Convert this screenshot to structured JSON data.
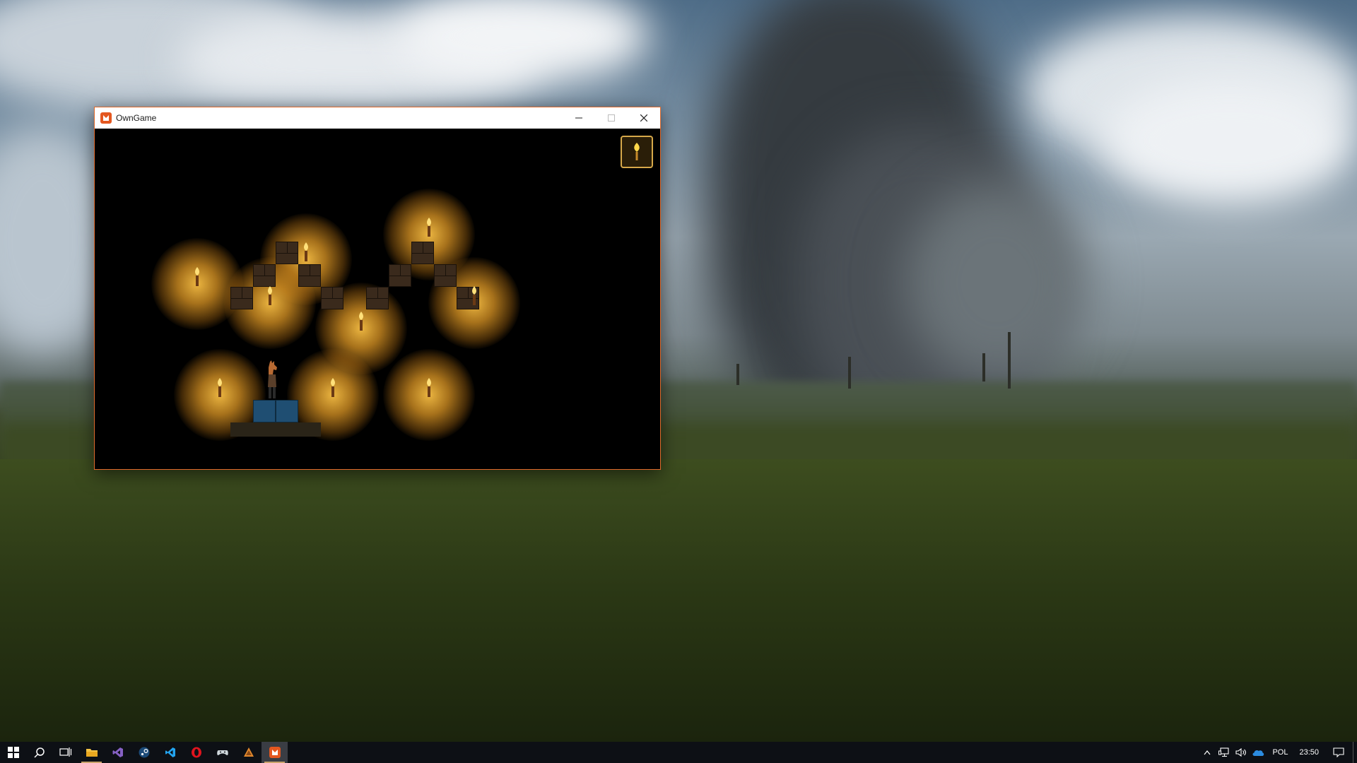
{
  "window": {
    "title": "OwnGame"
  },
  "taskbar": {
    "apps": [
      {
        "name": "start-button-icon"
      },
      {
        "name": "search-icon"
      },
      {
        "name": "task-view-icon"
      },
      {
        "name": "file-explorer-icon"
      },
      {
        "name": "visual-studio-icon"
      },
      {
        "name": "steam-icon"
      },
      {
        "name": "vs-code-icon"
      },
      {
        "name": "opera-icon"
      },
      {
        "name": "game-launcher-icon"
      },
      {
        "name": "unity-icon"
      },
      {
        "name": "monogame-icon"
      }
    ],
    "language": "POL",
    "time": "23:50"
  },
  "colors": {
    "window_border": "#e06a2c",
    "torch_glow": "#f2b84a",
    "brick": "#3a2a1c",
    "pedestal": "#1f4e72",
    "taskbar": "#0d1015"
  }
}
